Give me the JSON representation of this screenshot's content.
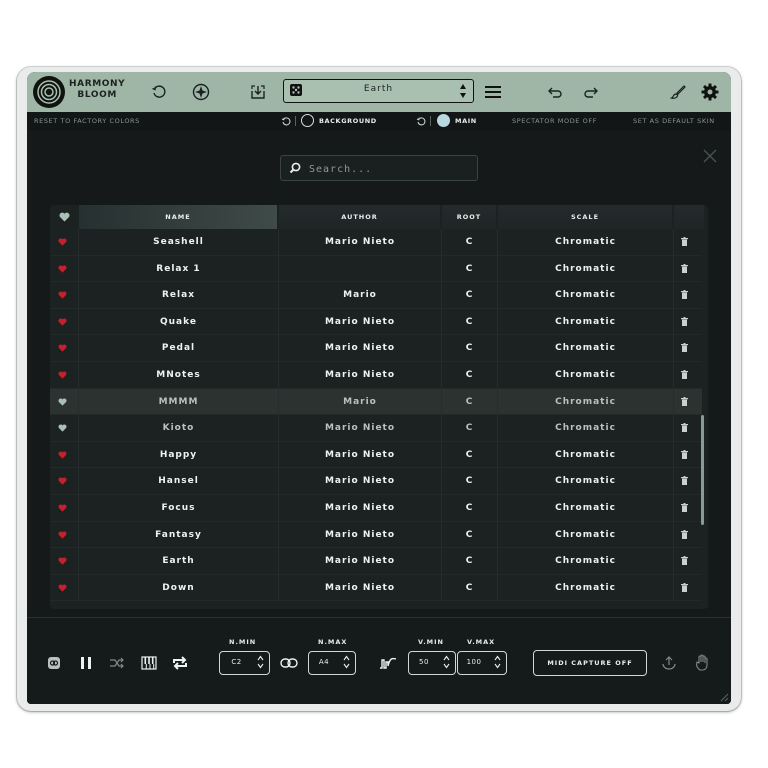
{
  "app": {
    "logo_line1": "HARMONY",
    "logo_line2": "BLOOM",
    "preset_name": "Earth"
  },
  "subbar": {
    "reset": "RESET TO FACTORY COLORS",
    "background": "BACKGROUND",
    "main": "MAIN",
    "spectator": "SPECTATOR MODE OFF",
    "default_skin": "SET AS DEFAULT SKIN"
  },
  "search": {
    "placeholder": "Search..."
  },
  "table": {
    "headers": {
      "name": "NAME",
      "author": "AUTHOR",
      "root": "ROOT",
      "scale": "SCALE"
    },
    "rows": [
      {
        "name": "Seashell",
        "author": "Mario Nieto",
        "root": "C",
        "scale": "Chromatic",
        "fav": true
      },
      {
        "name": "Relax 1",
        "author": "",
        "root": "C",
        "scale": "Chromatic",
        "fav": true
      },
      {
        "name": "Relax",
        "author": "Mario",
        "root": "C",
        "scale": "Chromatic",
        "fav": true
      },
      {
        "name": "Quake",
        "author": "Mario Nieto",
        "root": "C",
        "scale": "Chromatic",
        "fav": true
      },
      {
        "name": "Pedal",
        "author": "Mario Nieto",
        "root": "C",
        "scale": "Chromatic",
        "fav": true
      },
      {
        "name": "MNotes",
        "author": "Mario Nieto",
        "root": "C",
        "scale": "Chromatic",
        "fav": true
      },
      {
        "name": "MMMM",
        "author": "Mario",
        "root": "C",
        "scale": "Chromatic",
        "fav": false
      },
      {
        "name": "Kioto",
        "author": "Mario Nieto",
        "root": "C",
        "scale": "Chromatic",
        "fav": false
      },
      {
        "name": "Happy",
        "author": "Mario Nieto",
        "root": "C",
        "scale": "Chromatic",
        "fav": true
      },
      {
        "name": "Hansel",
        "author": "Mario Nieto",
        "root": "C",
        "scale": "Chromatic",
        "fav": true
      },
      {
        "name": "Focus",
        "author": "Mario Nieto",
        "root": "C",
        "scale": "Chromatic",
        "fav": true
      },
      {
        "name": "Fantasy",
        "author": "Mario Nieto",
        "root": "C",
        "scale": "Chromatic",
        "fav": true
      },
      {
        "name": "Earth",
        "author": "Mario Nieto",
        "root": "C",
        "scale": "Chromatic",
        "fav": true
      },
      {
        "name": "Down",
        "author": "Mario Nieto",
        "root": "C",
        "scale": "Chromatic",
        "fav": true
      }
    ]
  },
  "bottom": {
    "nmin_label": "N.MIN",
    "nmin_value": "C2",
    "nmax_label": "N.MAX",
    "nmax_value": "A4",
    "vmin_label": "V.MIN",
    "vmin_value": "50",
    "vmax_label": "V.MAX",
    "vmax_value": "100",
    "midi_capture": "MIDI CAPTURE OFF"
  },
  "colors": {
    "header_bg": "#9fb6a7",
    "app_bg": "#15191a",
    "fav_heart": "#c8202a",
    "unfav_heart": "#a9c1b3",
    "main_accent": "#b8d8e0"
  },
  "icons": {
    "header": [
      "logo-icon",
      "reset-icon",
      "compass-icon",
      "save-icon",
      "dice-icon",
      "menu-icon",
      "undo-icon",
      "redo-icon",
      "brush-icon",
      "gear-icon"
    ],
    "bottom": [
      "link-icon",
      "pause-icon",
      "shuffle-icon",
      "piano-icon",
      "repeat-icon",
      "chain-icon",
      "waveform-icon",
      "upload-icon",
      "hand-icon"
    ]
  }
}
